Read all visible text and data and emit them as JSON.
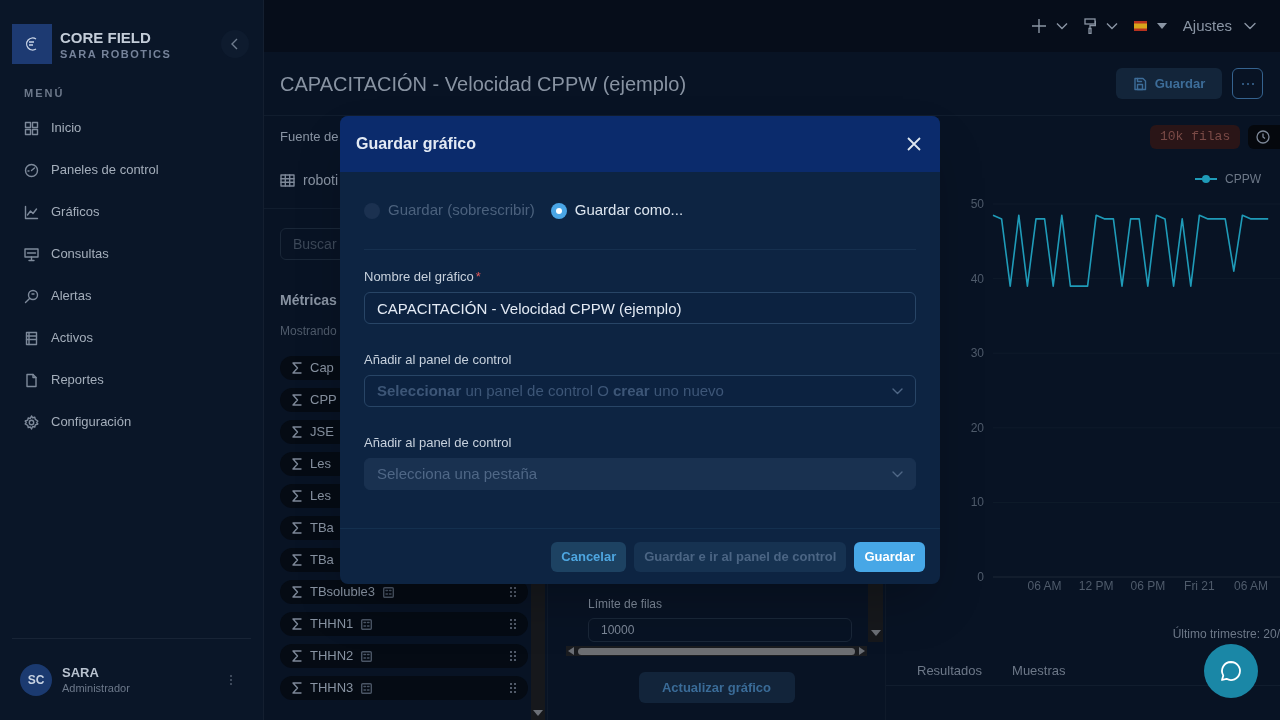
{
  "top_bar": {
    "settings_label": "Ajustes"
  },
  "sidebar": {
    "brand": "CORE FIELD",
    "org": "SARA ROBOTICS",
    "section": "MENÚ",
    "items": [
      {
        "label": "Inicio",
        "selected": false
      },
      {
        "label": "Paneles de control",
        "selected": false
      },
      {
        "label": "Gráficos",
        "selected": false
      },
      {
        "label": "Consultas",
        "selected": false
      },
      {
        "label": "Alertas",
        "selected": false
      },
      {
        "label": "Activos",
        "selected": false
      },
      {
        "label": "Reportes",
        "selected": false
      },
      {
        "label": "Configuración",
        "selected": false
      }
    ],
    "user": {
      "initials": "SC",
      "name": "SARA",
      "role": "Administrador"
    }
  },
  "page": {
    "title": "CAPACITACIÓN - Velocidad CPPW (ejemplo)",
    "save_button": "Guardar"
  },
  "data_panel": {
    "source_label": "Fuente de",
    "table": "roboti",
    "search_placeholder": "Buscar",
    "metrics_heading": "Métricas",
    "showing": "Mostrando",
    "metrics": [
      {
        "name": "Cap"
      },
      {
        "name": "CPP"
      },
      {
        "name": "JSE"
      },
      {
        "name": "Les"
      },
      {
        "name": "Les"
      },
      {
        "name": "TBa"
      },
      {
        "name": "TBa"
      },
      {
        "name": "TBsoluble3"
      },
      {
        "name": "THHN1"
      },
      {
        "name": "THHN2"
      },
      {
        "name": "THHN3"
      }
    ]
  },
  "query_panel": {
    "row_limit_label": "Límite de filas",
    "row_limit": "10000",
    "update_button": "Actualizar gráfico"
  },
  "chart_panel": {
    "rows_badge": "10k filas",
    "x_axis_labels": [
      "06 AM",
      "12 PM",
      "06 PM",
      "Fri 21",
      "06 AM"
    ],
    "chart_data": {
      "type": "line",
      "series": [
        {
          "name": "CPPW",
          "color": "#1f9bb8",
          "values": [
            48.5,
            48,
            39,
            48.5,
            39,
            48,
            48,
            39,
            48.5,
            39,
            39,
            39,
            48.5,
            48,
            48,
            39,
            48,
            48,
            39,
            48.5,
            48,
            39,
            48,
            39,
            48.5,
            48,
            48,
            48,
            41,
            48.5,
            48,
            48,
            48
          ]
        }
      ],
      "ylim": [
        0,
        50
      ],
      "yticks": [
        0,
        10,
        20,
        30,
        40,
        50
      ]
    },
    "range_note": "Último trimestre: 20/",
    "tabs": [
      {
        "label": "Resultados",
        "selected": false
      },
      {
        "label": "Muestras",
        "selected": false
      }
    ]
  },
  "dialog": {
    "title": "Guardar gráfico",
    "modes": [
      {
        "label": "Guardar (sobrescribir)",
        "selected": false,
        "disabled": true
      },
      {
        "label": "Guardar como...",
        "selected": true,
        "disabled": false
      }
    ],
    "name_label": "Nombre del gráfico",
    "required_mark": "*",
    "name_value": "CAPACITACIÓN - Velocidad CPPW (ejemplo)",
    "dashboard_label": "Añadir al panel de control",
    "dashboard_placeholder": "**Seleccionar** un panel de control O **crear** uno nuevo",
    "dashboard_disabled": false,
    "tab_label": "Añadir al panel de control",
    "tab_placeholder": "Selecciona una pestaña",
    "tab_disabled": true,
    "buttons": [
      {
        "label": "Cancelar",
        "kind": "secondary"
      },
      {
        "label": "Guardar e ir al panel de control",
        "kind": "disabled"
      },
      {
        "label": "Guardar",
        "kind": "primary"
      }
    ]
  }
}
